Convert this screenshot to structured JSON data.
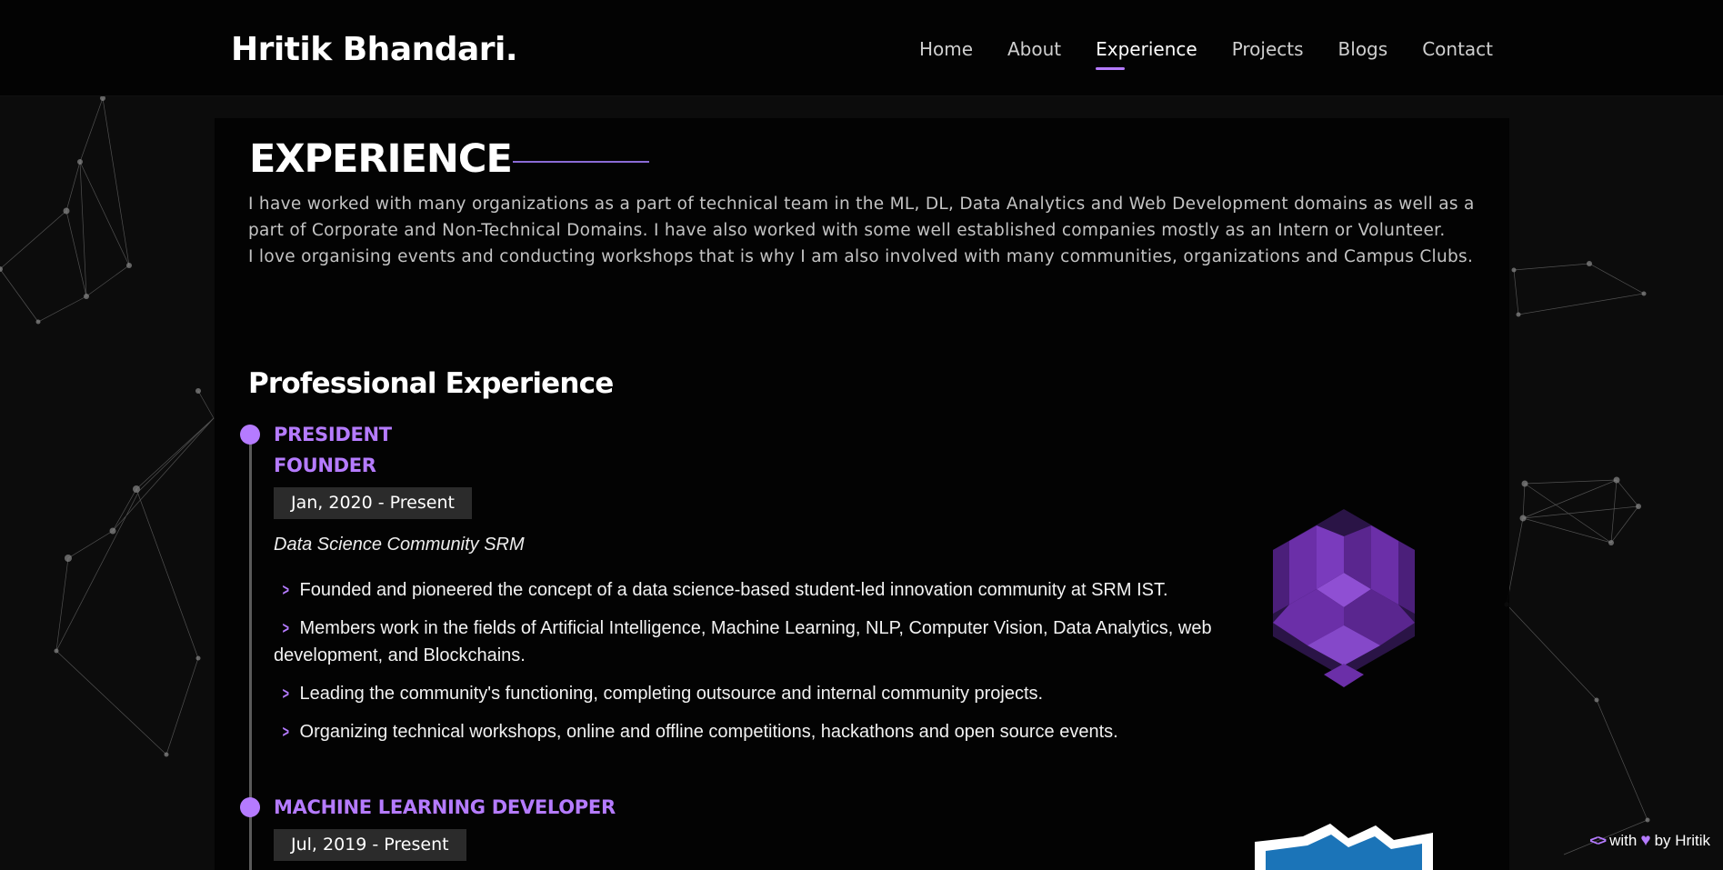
{
  "brand": "Hritik Bhandari.",
  "nav": {
    "items": [
      "Home",
      "About",
      "Experience",
      "Projects",
      "Blogs",
      "Contact"
    ],
    "active": "Experience"
  },
  "section": {
    "title": "EXPERIENCE",
    "intro": [
      "I have worked with many organizations as a part of technical team in the ML, DL, Data Analytics and Web Development domains as well as a part of Corporate and Non-Technical Domains. I have also worked with some well established companies mostly as an Intern or Volunteer.",
      "I love organising events and conducting workshops that is why I am also involved with many communities, organizations and Campus Clubs."
    ],
    "subheading": "Professional Experience"
  },
  "experiences": [
    {
      "roles": [
        "PRESIDENT",
        "FOUNDER"
      ],
      "date": "Jan, 2020 - Present",
      "organization": "Data Science Community SRM",
      "bullets": [
        "Founded and pioneered the concept of a data science-based student-led innovation community at SRM IST.",
        "Members work in the fields of Artificial Intelligence, Machine Learning, NLP, Computer Vision, Data Analytics, web development, and Blockchains.",
        "Leading the community's functioning, completing outsource and internal community projects.",
        "Organizing technical workshops, online and offline competitions, hackathons and open source events."
      ]
    },
    {
      "roles": [
        "MACHINE LEARNING DEVELOPER"
      ],
      "date": "Jul, 2019 - Present"
    }
  ],
  "footer": {
    "with": "with",
    "by": "by Hritik"
  },
  "colors": {
    "accent": "#b57bff",
    "background": "#0c0c0c",
    "panel": "#030303",
    "badge": "#2b2b2b"
  },
  "icons": [
    "chevron-right-icon",
    "code-icon",
    "heart-icon"
  ]
}
